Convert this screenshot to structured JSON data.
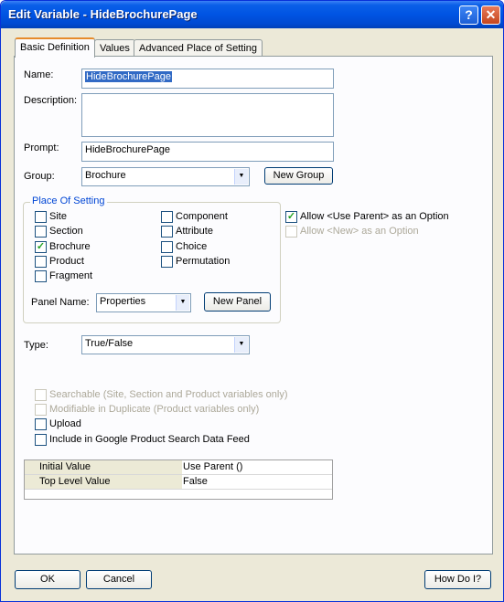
{
  "window": {
    "title": "Edit Variable - HideBrochurePage",
    "help_glyph": "?",
    "close_glyph": "✕"
  },
  "tabs": [
    {
      "label": "Basic Definition"
    },
    {
      "label": "Values"
    },
    {
      "label": "Advanced Place of Setting"
    }
  ],
  "form": {
    "name_label": "Name:",
    "name_value": "HideBrochurePage",
    "description_label": "Description:",
    "description_value": "",
    "prompt_label": "Prompt:",
    "prompt_value": "HideBrochurePage",
    "group_label": "Group:",
    "group_value": "Brochure",
    "new_group_button": "New Group",
    "type_label": "Type:",
    "type_value": "True/False"
  },
  "place_of_setting": {
    "title": "Place Of Setting",
    "items": [
      {
        "label": "Site",
        "checked": false
      },
      {
        "label": "Section",
        "checked": false
      },
      {
        "label": "Brochure",
        "checked": true
      },
      {
        "label": "Product",
        "checked": false
      },
      {
        "label": "Fragment",
        "checked": false
      },
      {
        "label": "Component",
        "checked": false
      },
      {
        "label": "Attribute",
        "checked": false
      },
      {
        "label": "Choice",
        "checked": false
      },
      {
        "label": "Permutation",
        "checked": false
      }
    ],
    "panel_name_label": "Panel Name:",
    "panel_name_value": "Properties",
    "new_panel_button": "New Panel"
  },
  "options": {
    "allow_parent": {
      "label": "Allow <Use Parent> as an Option",
      "checked": true
    },
    "allow_new": {
      "label": "Allow <New> as an Option",
      "checked": false,
      "disabled": true
    }
  },
  "flags": {
    "searchable": {
      "label": "Searchable (Site, Section and Product variables only)",
      "disabled": true
    },
    "modifiable": {
      "label": "Modifiable in Duplicate (Product variables only)",
      "disabled": true
    },
    "upload": {
      "label": "Upload"
    },
    "google": {
      "label": "Include in Google Product Search Data Feed"
    }
  },
  "value_grid": [
    {
      "label": "Initial Value",
      "value": "Use Parent ()"
    },
    {
      "label": "Top Level Value",
      "value": "False"
    }
  ],
  "footer": {
    "ok": "OK",
    "cancel": "Cancel",
    "how_do_i": "How Do I?"
  },
  "check_glyph": "✓",
  "combo_arrow": "▼"
}
